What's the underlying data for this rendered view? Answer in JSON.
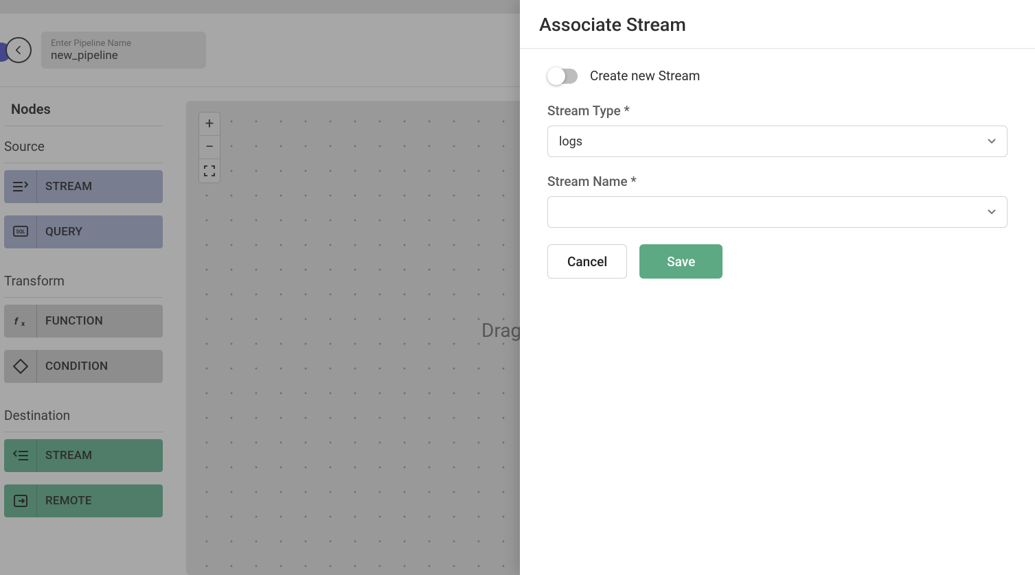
{
  "header": {
    "pipeline_name_placeholder": "Enter Pipeline Name",
    "pipeline_name_value": "new_pipeline"
  },
  "sidebar": {
    "nodes_title": "Nodes",
    "sections": {
      "source": {
        "title": "Source",
        "stream": "STREAM",
        "query": "QUERY"
      },
      "transform": {
        "title": "Transform",
        "function": "FUNCTION",
        "condition": "CONDITION"
      },
      "destination": {
        "title": "Destination",
        "stream": "STREAM",
        "remote": "REMOTE"
      }
    }
  },
  "canvas": {
    "hint": "Drag"
  },
  "panel": {
    "title": "Associate Stream",
    "toggle_label": "Create new Stream",
    "stream_type_label": "Stream Type *",
    "stream_type_value": "logs",
    "stream_name_label": "Stream Name *",
    "stream_name_value": "",
    "cancel": "Cancel",
    "save": "Save"
  }
}
